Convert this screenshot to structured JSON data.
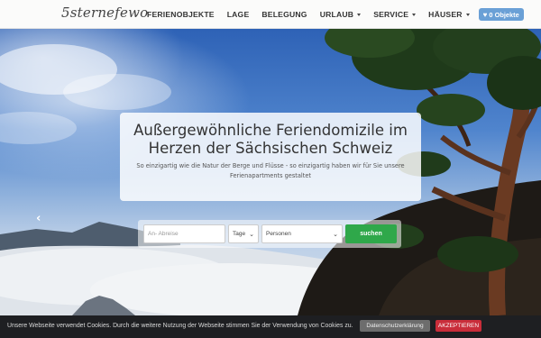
{
  "brand": "5sternefewo",
  "nav": {
    "items": [
      {
        "label": "FERIENOBJEKTE",
        "dropdown": false
      },
      {
        "label": "LAGE",
        "dropdown": false
      },
      {
        "label": "BELEGUNG",
        "dropdown": false
      },
      {
        "label": "URLAUB",
        "dropdown": true
      },
      {
        "label": "SERVICE",
        "dropdown": true
      },
      {
        "label": "HÄUSER",
        "dropdown": true
      }
    ],
    "cart_label": "0 Objekte"
  },
  "hero": {
    "headline_line1": "Außergewöhnliche Feriendomizile im",
    "headline_line2": "Herzen der Sächsischen Schweiz",
    "subtitle": "So einzigartig wie die Natur der Berge und Flüsse - so einzigartig haben wir für Sie unsere Ferienapartments gestaltet"
  },
  "search": {
    "dates_placeholder": "An- Abreise",
    "nights_selected": "Tage",
    "persons_selected": "Personen",
    "submit_label": "suchen"
  },
  "cookie": {
    "text": "Unsere Webseite verwendet Cookies. Durch die weitere Nutzung der Webseite stimmen Sie der Verwendung von Cookies zu.",
    "privacy_label": "Datenschutzerklärung",
    "accept_label": "AKZEPTIEREN"
  },
  "colors": {
    "accent_search": "#2fa84a",
    "accent_accept": "#c92d3a",
    "cart_badge": "#6aa0d6"
  }
}
